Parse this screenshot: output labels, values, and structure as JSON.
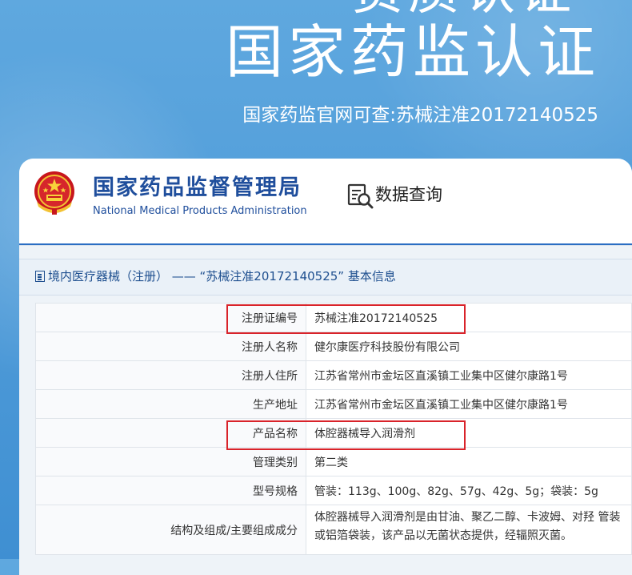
{
  "hero": {
    "top_partial": "资质认证",
    "title": "国家药监认证",
    "subtitle": "国家药监官网可查:苏械注准20172140525"
  },
  "header": {
    "agency_cn": "国家药品监督管理局",
    "agency_en": "National Medical Products Administration",
    "query_label": "数据查询"
  },
  "breadcrumb": "境内医疗器械（注册） —— “苏械注准20172140525” 基本信息",
  "table": [
    {
      "label": "注册证编号",
      "value": "苏械注准20172140525"
    },
    {
      "label": "注册人名称",
      "value": "健尔康医疗科技股份有限公司"
    },
    {
      "label": "注册人住所",
      "value": "江苏省常州市金坛区直溪镇工业集中区健尔康路1号"
    },
    {
      "label": "生产地址",
      "value": "江苏省常州市金坛区直溪镇工业集中区健尔康路1号"
    },
    {
      "label": "产品名称",
      "value": "体腔器械导入润滑剂"
    },
    {
      "label": "管理类别",
      "value": "第二类"
    },
    {
      "label": "型号规格",
      "value": "管装：113g、100g、82g、57g、42g、5g；袋装：5g"
    },
    {
      "label": "结构及组成/主要组成成分",
      "value": "体腔器械导入润滑剂是由甘油、聚乙二醇、卡波姆、对羟 管装或铝箔袋装，该产品以无菌状态提供，经辐照灭菌。"
    }
  ],
  "colors": {
    "background": "#4a98d8",
    "agency_blue": "#1f4e9c",
    "highlight_red": "#d9232a"
  }
}
